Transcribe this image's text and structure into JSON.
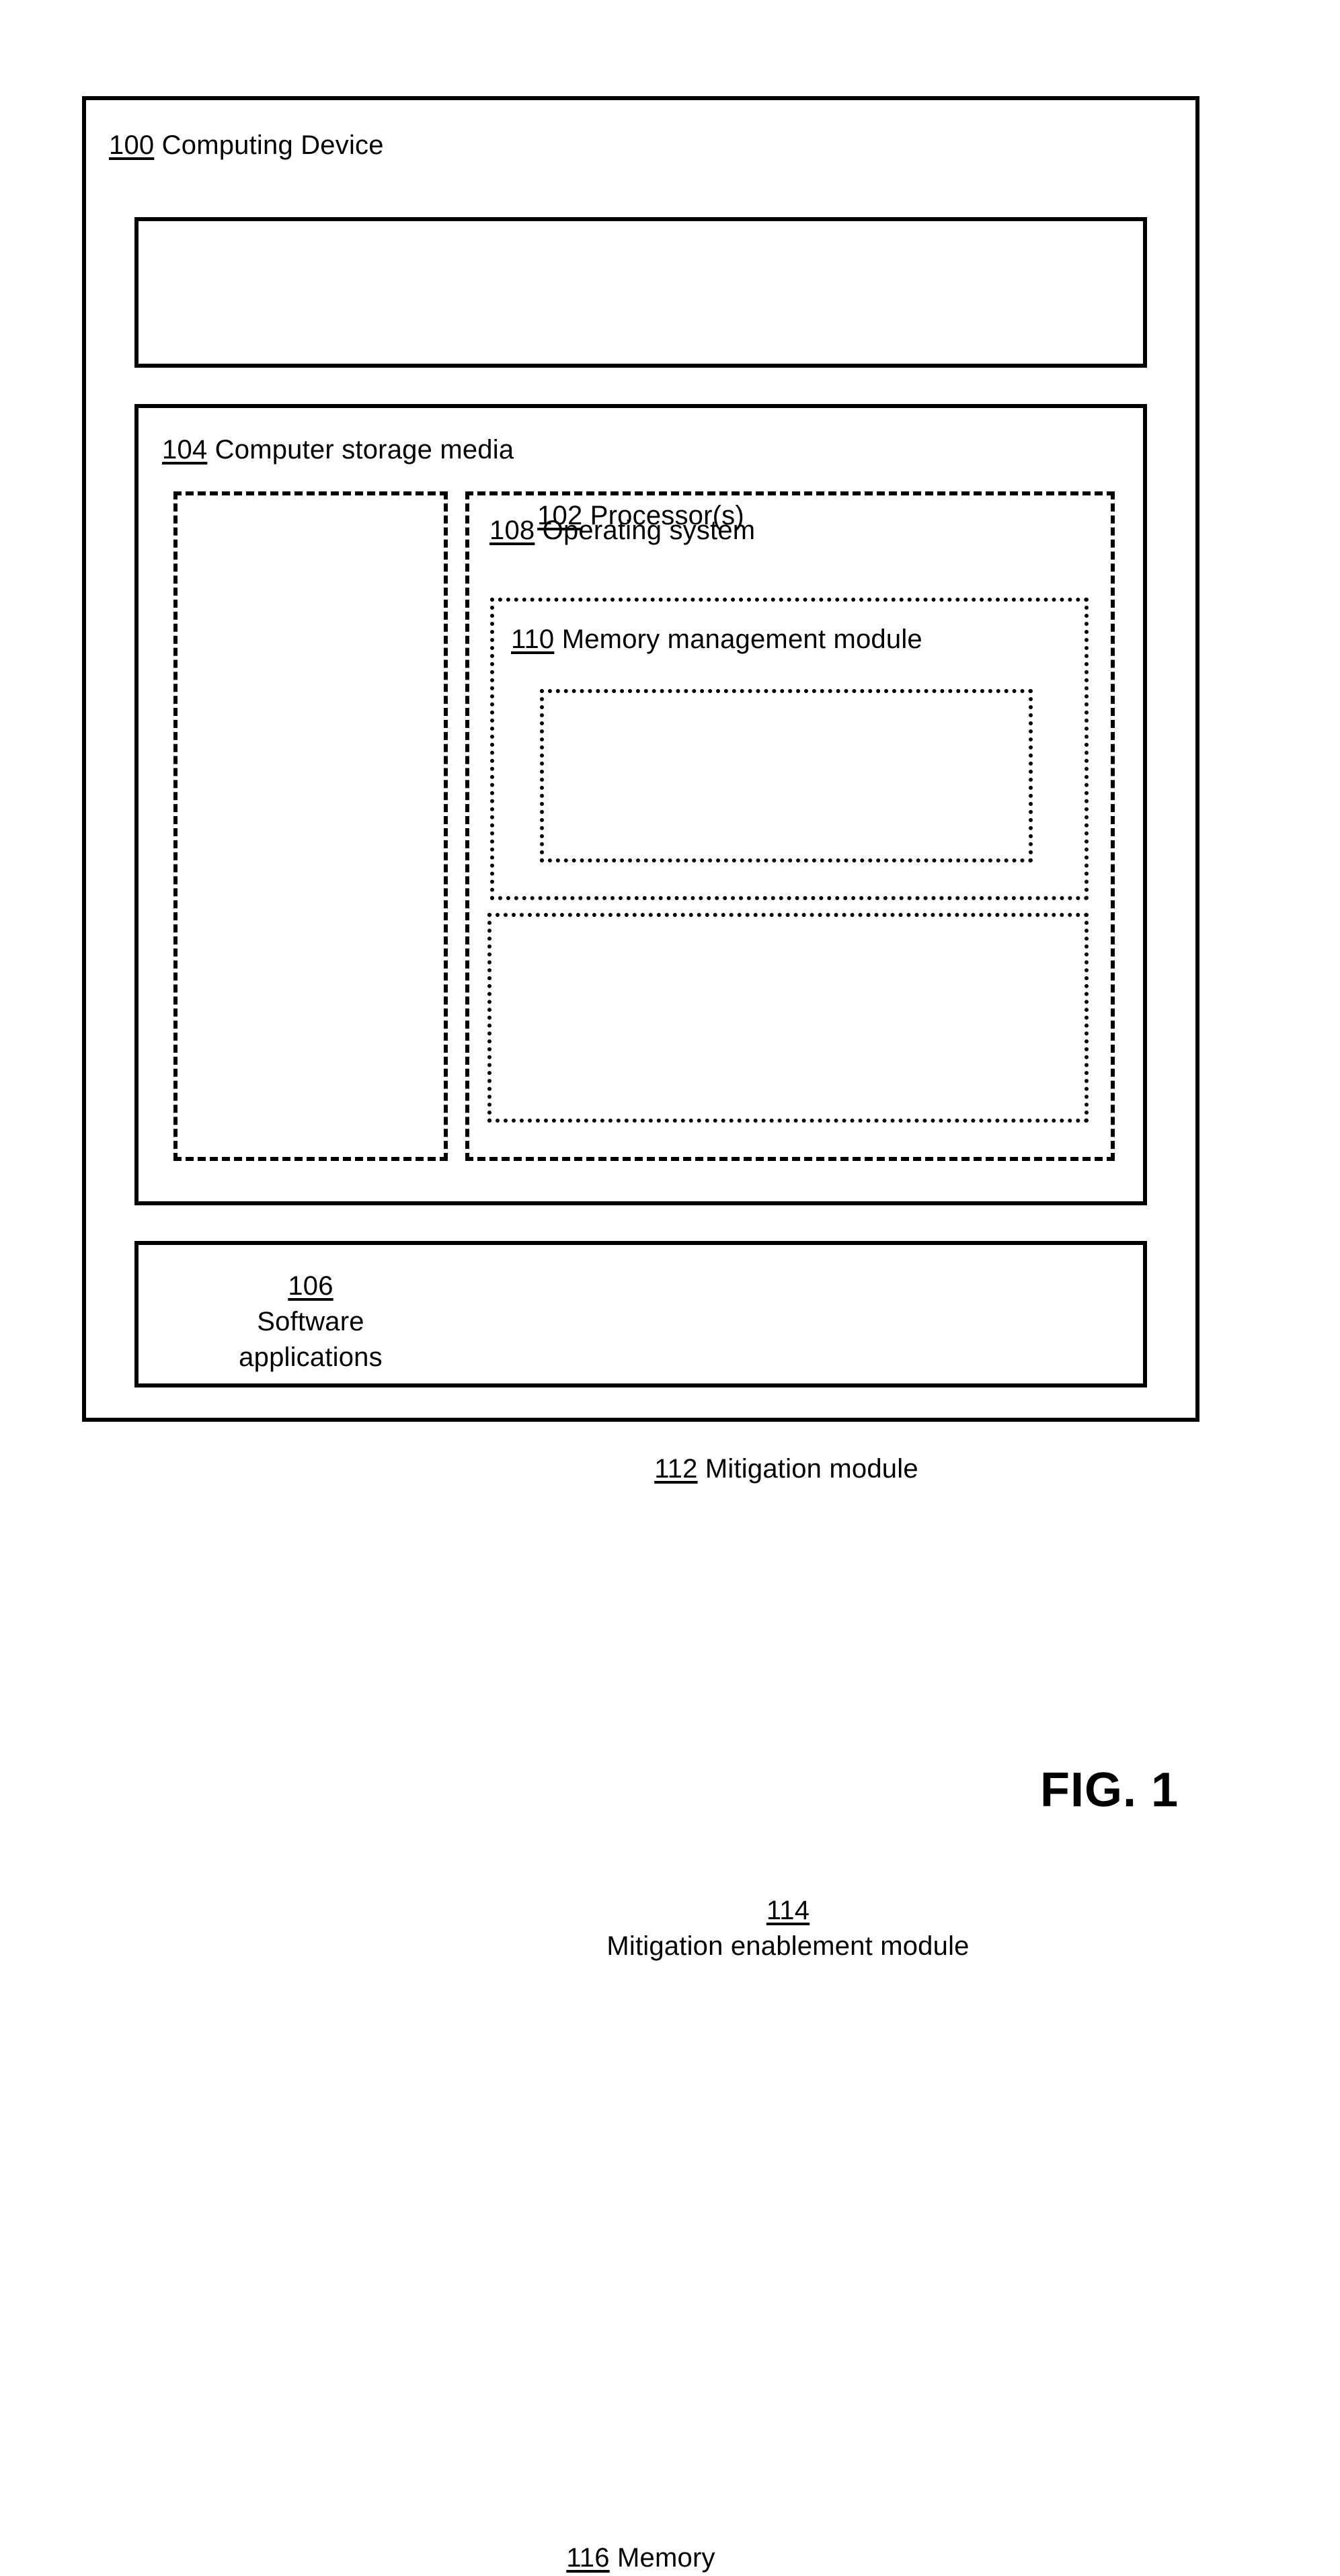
{
  "figure": {
    "caption": "FIG. 1"
  },
  "diagram": {
    "type": "block-diagram",
    "blocks": {
      "computing_device": {
        "ref": "100",
        "label": "Computing Device",
        "border": "solid"
      },
      "processors": {
        "ref": "102",
        "label": "Processor(s)",
        "border": "solid"
      },
      "computer_storage_media": {
        "ref": "104",
        "label": "Computer storage media",
        "border": "solid"
      },
      "software_applications": {
        "ref": "106",
        "label_line_1": "Software",
        "label_line_2": "applications",
        "border": "dashed"
      },
      "operating_system": {
        "ref": "108",
        "label": "Operating system",
        "border": "dashed"
      },
      "memory_management_module": {
        "ref": "110",
        "label": "Memory management module",
        "border": "dotted"
      },
      "mitigation_module": {
        "ref": "112",
        "label": "Mitigation module",
        "border": "dotted"
      },
      "mitigation_enablement_module": {
        "ref": "114",
        "label": "Mitigation enablement module",
        "border": "dotted"
      },
      "memory": {
        "ref": "116",
        "label": "Memory",
        "border": "solid"
      }
    }
  }
}
